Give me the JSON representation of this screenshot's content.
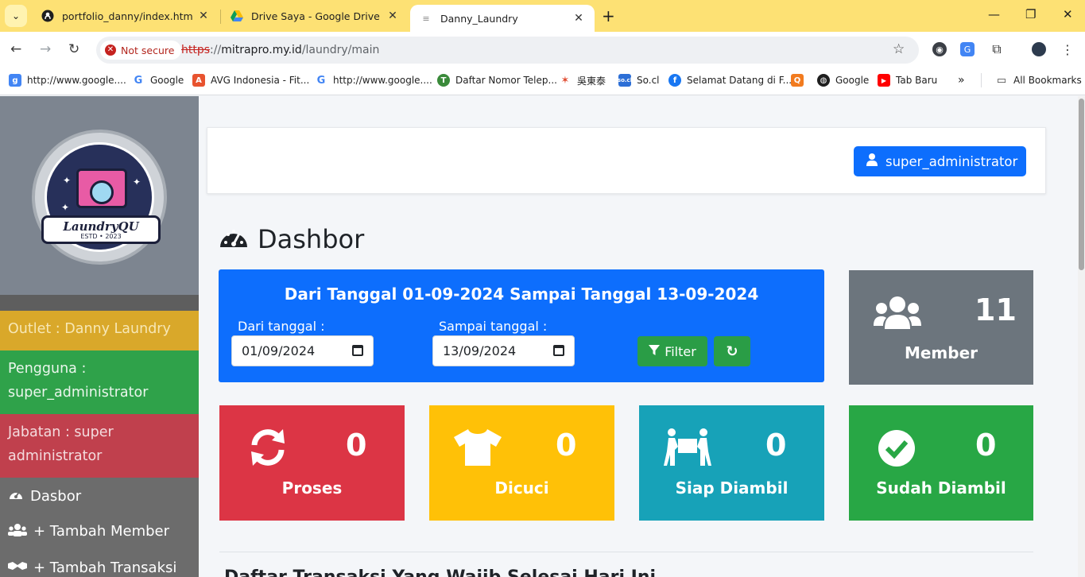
{
  "browser": {
    "tabs": [
      {
        "title": "portfolio_danny/index.html at m",
        "icon": "github-icon"
      },
      {
        "title": "Drive Saya - Google Drive",
        "icon": "google-drive-icon"
      },
      {
        "title": "Danny_Laundry",
        "icon": "page-icon"
      }
    ],
    "security_label": "Not secure",
    "url_scheme": "https",
    "url_sep": "://",
    "url_host": "mitrapro.my.id",
    "url_path": "/laundry/main",
    "bookmarks": [
      "http://www.google....",
      "Google",
      "AVG Indonesia - Fit...",
      "http://www.google....",
      "Daftar Nomor Telep...",
      "吳東泰",
      "So.cl",
      "Selamat Datang di F...",
      "",
      "Google",
      "Tab Baru"
    ],
    "all_bookmarks": "All Bookmarks"
  },
  "sidebar": {
    "logo_name": "LaundryQU",
    "logo_estd": "ESTD • 2023",
    "outlet": "Outlet : Danny Laundry",
    "user_line1": "Pengguna :",
    "user_line2": "super_administrator",
    "role_line1": "Jabatan : super",
    "role_line2": "administrator",
    "nav": [
      "Dasbor",
      "+ Tambah Member",
      "+ Tambah Transaksi"
    ]
  },
  "header": {
    "user_button": "super_administrator"
  },
  "main": {
    "title": "Dashbor",
    "filter": {
      "heading": "Dari Tanggal 01-09-2024 Sampai Tanggal 13-09-2024",
      "from_label": "Dari tanggal :",
      "from_value": "01/09/2024",
      "to_label": "Sampai tanggal :",
      "to_value": "13/09/2024",
      "filter_button": "Filter"
    },
    "stats": {
      "member": {
        "value": "11",
        "label": "Member",
        "color": "#6c757d"
      },
      "proses": {
        "value": "0",
        "label": "Proses",
        "color": "#dc3545"
      },
      "dicuci": {
        "value": "0",
        "label": "Dicuci",
        "color": "#ffc107"
      },
      "siap": {
        "value": "0",
        "label": "Siap Diambil",
        "color": "#17a2b8"
      },
      "sudah": {
        "value": "0",
        "label": "Sudah Diambil",
        "color": "#28a745"
      }
    },
    "section_cut": "Daftar Transaksi Yang Wajib Selesai Hari Ini"
  }
}
